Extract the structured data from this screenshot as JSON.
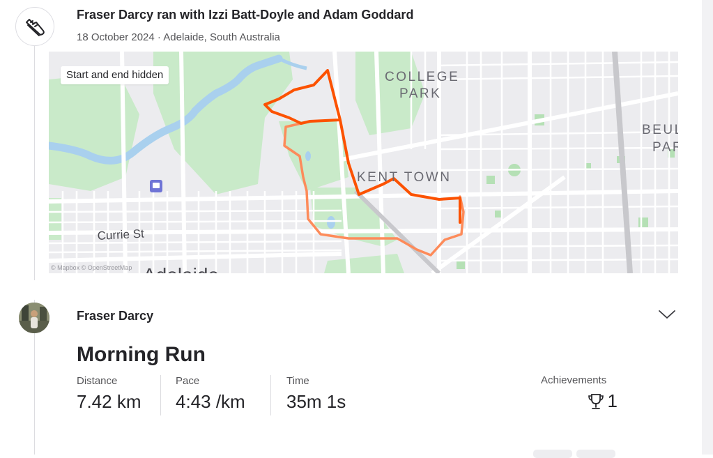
{
  "group": {
    "title": "Fraser Darcy ran with Izzi Batt-Doyle and Adam Goddard",
    "meta": "18 October 2024 · Adelaide, South Australia",
    "icon": "running-shoe-icon"
  },
  "map": {
    "privacy_notice": "Start and end hidden",
    "labels": {
      "college": "COLLEGE",
      "park": "PARK",
      "kent_town": "KENT TOWN",
      "beul": "BEUL",
      "par": "PAR",
      "currie": "Currie St",
      "adelaide": "Adelaide"
    },
    "attribution": "© Mapbox © OpenStreetMap",
    "route_colors": {
      "primary": "#fc5200",
      "secondary": "#fd8b5a"
    }
  },
  "activity": {
    "athlete": "Fraser Darcy",
    "title": "Morning Run",
    "stats": [
      {
        "label": "Distance",
        "value": "7.42 km"
      },
      {
        "label": "Pace",
        "value": "4:43 /km"
      },
      {
        "label": "Time",
        "value": "35m 1s"
      }
    ],
    "achievements": {
      "label": "Achievements",
      "value": "1",
      "icon": "trophy-icon"
    }
  }
}
